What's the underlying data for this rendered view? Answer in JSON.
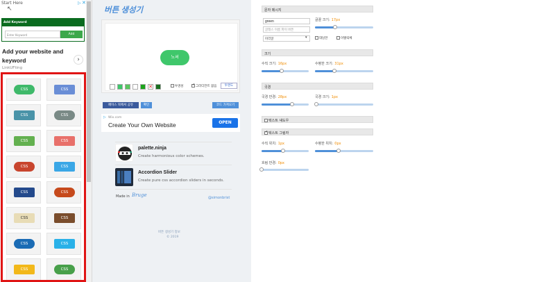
{
  "ad_top": {
    "start_text": "Start Here",
    "choices_label": "▷",
    "close_label": "✕",
    "box_heading": "Add Keyword",
    "box_input_placeholder": "Enter Keyword",
    "box_button": "Add",
    "headline": "Add your website and keyword",
    "brand": "LinkUFting"
  },
  "gallery": {
    "tiles": [
      {
        "label": "CSS",
        "color": "#3fb96a"
      },
      {
        "label": "CSS",
        "color": "#6a8ed6"
      },
      {
        "label": "CSS",
        "color": "#4a93a8"
      },
      {
        "label": "CSS",
        "color": "#7a8a86"
      },
      {
        "label": "CSS",
        "color": "#63b04f"
      },
      {
        "label": "CSS",
        "color": "#e8706a"
      },
      {
        "label": "CSS",
        "color": "#c8452e"
      },
      {
        "label": "CSS",
        "color": "#3aa7e6"
      },
      {
        "label": "CSS",
        "color": "#244a8c"
      },
      {
        "label": "CSS",
        "color": "#c64a1c"
      },
      {
        "label": "CSS",
        "color": "#e8dcb6"
      },
      {
        "label": "CSS",
        "color": "#7a4d2c"
      },
      {
        "label": "CSS",
        "color": "#1b6cb5"
      },
      {
        "label": "CSS",
        "color": "#2ab1e8"
      },
      {
        "label": "CSS",
        "color": "#f2b81a"
      },
      {
        "label": "CSS",
        "color": "#48a04a"
      }
    ]
  },
  "center": {
    "title": "버튼 생성기",
    "demo_button": "노셔",
    "swatches": [
      "#ffffff",
      "#3fc76b",
      "#5ac85f",
      "#ffffff",
      "#1ca41c",
      "#ffffff",
      "#1a6f20"
    ],
    "chk_bg": "투명성",
    "chk_grad": "그라디언트 없음",
    "btn_transparent": "투명도",
    "btn_share": "페이스 북에서 공유",
    "btn_ok": "확인",
    "btn_copy": "코드 가져오기",
    "ad2_domain": "Wix.com",
    "ad2_text": "Create Your Own Website",
    "ad2_open": "OPEN",
    "related": [
      {
        "title": "palette.ninja",
        "desc": "Create harmonious color schemes."
      },
      {
        "title": "Accordion Slider",
        "desc": "Create pure css accordion sliders in seconds."
      }
    ],
    "made_in": "Made in",
    "made_in_logo": "Bruge",
    "handle": "@simonbrist",
    "footer_link": "버튼 생성기 정보",
    "footer_copy": "© 2019"
  },
  "panel": {
    "sec_text": "문자 메시지",
    "text_value": "green",
    "text_placeholder": "글래스 이름   파이 버튼",
    "font_select": "아리알",
    "font_size_label": "글꼴 크기:",
    "font_size_value": "17px",
    "font_size_frac": 0.35,
    "chk_bold": "대담한",
    "chk_italic": "이탤릭체",
    "sec_size": "크기",
    "pad_v_label": "수직 크기:",
    "pad_v_value": "16px",
    "pad_v_frac": 0.42,
    "pad_h_label": "수평한 크기:",
    "pad_h_value": "31px",
    "pad_h_frac": 0.33,
    "sec_border": "국경",
    "radius_label": "국경 반경:",
    "radius_value": "28px",
    "radius_frac": 0.65,
    "border_w_label": "국경 크기:",
    "border_w_value": "1px",
    "border_w_frac": 0.02,
    "sec_text_shadow": "텍스트 섀도우",
    "sec_box_shadow": "텍스트 그림자",
    "sh_v_label": "수직 위치:",
    "sh_v_value": "1px",
    "sh_v_frac": 0.46,
    "sh_h_label": "수평한 위치:",
    "sh_h_value": "0px",
    "sh_h_frac": 0.41,
    "blur_label": "흐림 반경:",
    "blur_value": "0px",
    "blur_frac": 0.0
  }
}
